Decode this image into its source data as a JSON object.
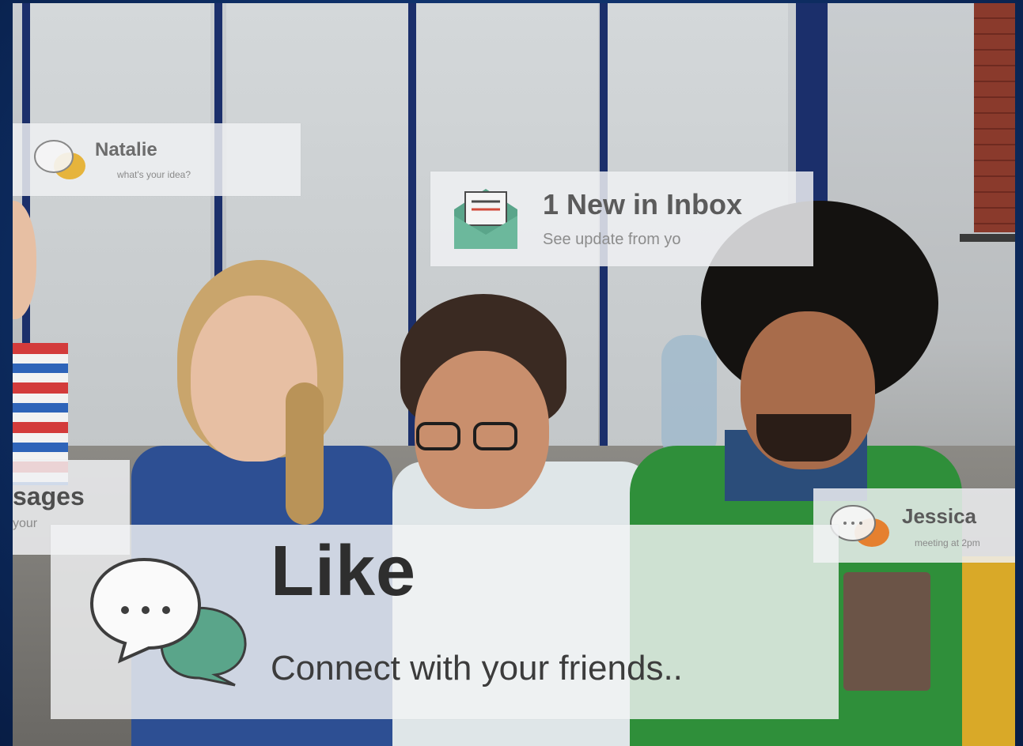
{
  "cards": {
    "natalie": {
      "name": "Natalie",
      "message": "what's your idea?"
    },
    "inbox": {
      "title": "1 New in Inbox",
      "subtitle": "See update from yo"
    },
    "messages": {
      "title": "sages",
      "subtitle": "your"
    },
    "jessica": {
      "name": "Jessica",
      "message": "meeting at 2pm"
    },
    "like": {
      "title": "Like",
      "subtitle": "Connect with your friends.."
    }
  },
  "colors": {
    "frame_blue": "#0e2f66",
    "bubble_green": "#5aa58a",
    "bubble_orange": "#e5802f",
    "bubble_yellow": "#e6b43c",
    "card_bg": "#f0f1f3"
  },
  "icons": {
    "chat": "chat-bubbles-icon",
    "mail": "envelope-icon"
  }
}
